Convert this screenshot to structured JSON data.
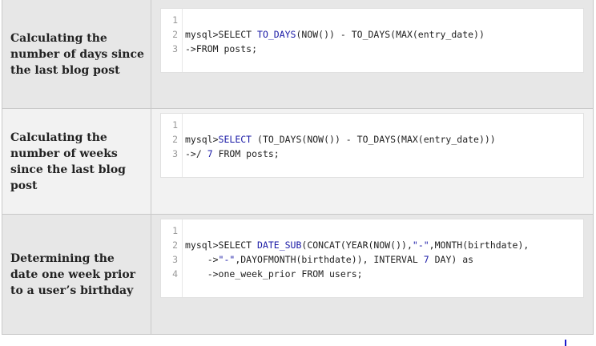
{
  "rows": [
    {
      "label": "Calculating the number of days since the last blog post",
      "line_numbers": [
        "1",
        "2",
        "3"
      ],
      "code": [
        [],
        [
          {
            "t": "mysql>SELECT ",
            "c": ""
          },
          {
            "t": "TO_DAYS",
            "c": "kw"
          },
          {
            "t": "(NOW()) - TO_DAYS(MAX(entry_date))",
            "c": ""
          }
        ],
        [
          {
            "t": "->FROM posts;",
            "c": ""
          }
        ]
      ]
    },
    {
      "label": "Calculating the number of weeks since the last blog post",
      "line_numbers": [
        "1",
        "2",
        "3"
      ],
      "code": [
        [],
        [
          {
            "t": "mysql>",
            "c": ""
          },
          {
            "t": "SELECT",
            "c": "kw"
          },
          {
            "t": " (TO_DAYS(NOW()) - TO_DAYS(MAX(entry_date)))",
            "c": ""
          }
        ],
        [
          {
            "t": "->/ ",
            "c": ""
          },
          {
            "t": "7",
            "c": "num"
          },
          {
            "t": " FROM posts;",
            "c": ""
          }
        ]
      ]
    },
    {
      "label": "Determining the date one week prior to a user’s birthday",
      "line_numbers": [
        "1",
        "2",
        "3",
        "4"
      ],
      "code": [
        [],
        [
          {
            "t": "mysql>SELECT ",
            "c": ""
          },
          {
            "t": "DATE_SUB",
            "c": "kw"
          },
          {
            "t": "(CONCAT(YEAR(NOW()),",
            "c": ""
          },
          {
            "t": "\"-\"",
            "c": "str"
          },
          {
            "t": ",MONTH(birthdate),",
            "c": ""
          }
        ],
        [
          {
            "t": "    ->",
            "c": ""
          },
          {
            "t": "\"-\"",
            "c": "str"
          },
          {
            "t": ",DAYOFMONTH(birthdate)), INTERVAL ",
            "c": ""
          },
          {
            "t": "7",
            "c": "num"
          },
          {
            "t": " DAY) as",
            "c": ""
          }
        ],
        [
          {
            "t": "    ->one_week_prior FROM users;",
            "c": ""
          }
        ]
      ]
    }
  ],
  "colors": {
    "keyword": "#1a1aa6",
    "row_bg_dark": "#e7e7e7",
    "row_bg_light": "#f2f2f2",
    "line_number": "#9a9a9a"
  }
}
